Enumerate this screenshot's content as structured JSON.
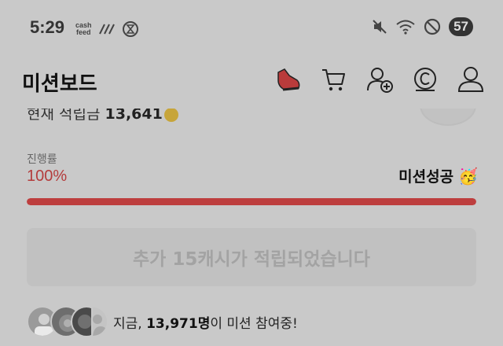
{
  "status_bar": {
    "time": "5:29",
    "app_badge": [
      "cash",
      "feed"
    ],
    "battery": "57"
  },
  "header": {
    "title": "미션보드",
    "icons": [
      "shoe-icon",
      "cart-icon",
      "add-friend-icon",
      "coin-c-icon",
      "profile-icon"
    ]
  },
  "summary": {
    "label_partial": "현재 적립금",
    "amount": "13,641"
  },
  "progress": {
    "label": "진행률",
    "value_text": "100%",
    "fraction": 1.0,
    "status": "미션성공",
    "status_emoji": "🥳"
  },
  "reward_button": {
    "label": "추가 15캐시가 적립되었습니다"
  },
  "participants": {
    "prefix": "지금, ",
    "count": "13,971명",
    "suffix": "이 미션 참여중!"
  },
  "colors": {
    "accent": "#bd3e3e",
    "progress_text": "#b43c3c"
  }
}
